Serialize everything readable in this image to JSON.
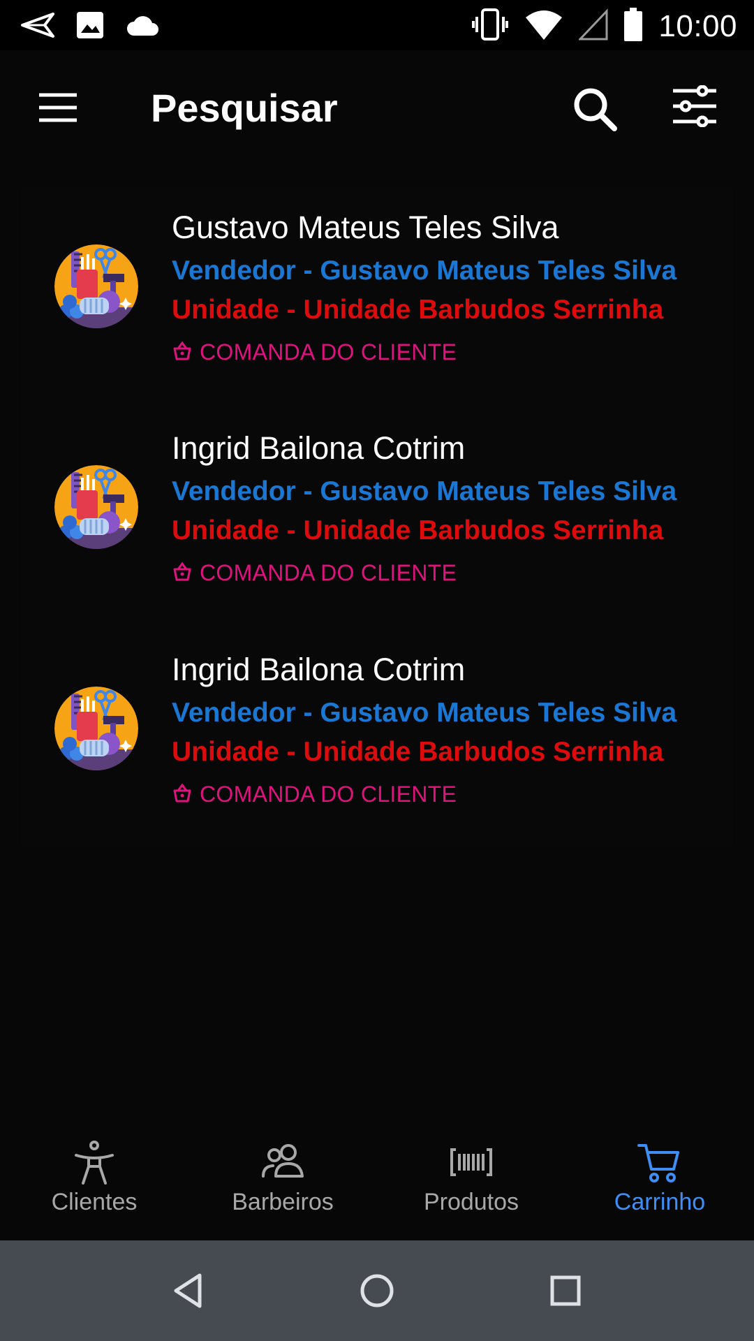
{
  "status_bar": {
    "time": "10:00",
    "icons": [
      "send-icon",
      "image-icon",
      "cloud-icon",
      "vibrate-icon",
      "wifi-icon",
      "signal-icon",
      "battery-icon"
    ]
  },
  "app_bar": {
    "title": "Pesquisar",
    "icons": [
      "menu-icon",
      "search-icon",
      "filter-icon"
    ]
  },
  "list": {
    "items": [
      {
        "name": "Gustavo Mateus Teles Silva",
        "seller": "Vendedor - Gustavo Mateus Teles Silva",
        "unit": "Unidade - Unidade Barbudos Serrinha",
        "comanda": "COMANDA DO CLIENTE"
      },
      {
        "name": "Ingrid Bailona Cotrim",
        "seller": "Vendedor - Gustavo Mateus Teles Silva",
        "unit": "Unidade - Unidade Barbudos Serrinha",
        "comanda": "COMANDA DO CLIENTE"
      },
      {
        "name": "Ingrid Bailona Cotrim",
        "seller": "Vendedor - Gustavo Mateus Teles Silva",
        "unit": "Unidade - Unidade Barbudos Serrinha",
        "comanda": "COMANDA DO CLIENTE"
      }
    ]
  },
  "bottom_nav": {
    "tabs": [
      {
        "label": "Clientes",
        "icon": "person-icon",
        "active": false
      },
      {
        "label": "Barbeiros",
        "icon": "people-icon",
        "active": false
      },
      {
        "label": "Produtos",
        "icon": "barcode-icon",
        "active": false
      },
      {
        "label": "Carrinho",
        "icon": "cart-icon",
        "active": true
      }
    ]
  },
  "colors": {
    "background": "#070707",
    "seller_text": "#1a78d4",
    "unit_text": "#dd0b0b",
    "comanda_text": "#e0127e",
    "active_tab": "#3f8ef5",
    "inactive_tab": "#a8a8a8",
    "system_nav": "#454b51"
  }
}
